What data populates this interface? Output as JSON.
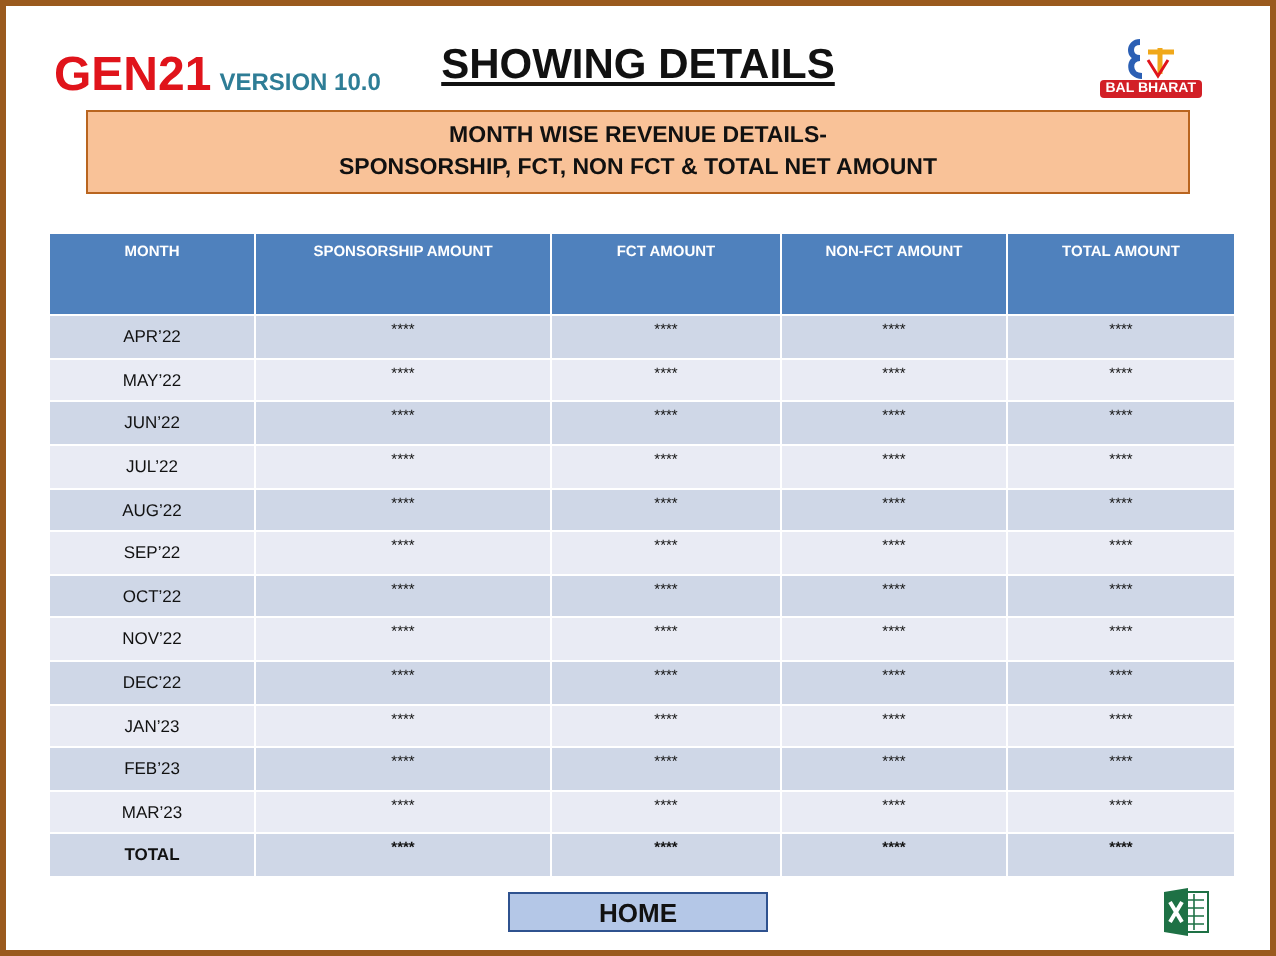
{
  "header": {
    "brand": "GEN21",
    "version": "VERSION 10.0",
    "title": "SHOWING DETAILS",
    "logo_badge": "BAL BHARAT"
  },
  "banner": {
    "lines": [
      "MONTH WISE REVENUE DETAILS-",
      "SPONSORSHIP, FCT, NON FCT & TOTAL NET AMOUNT"
    ]
  },
  "table": {
    "columns": [
      "MONTH",
      "SPONSORSHIP AMOUNT",
      "FCT AMOUNT",
      "NON-FCT AMOUNT",
      "TOTAL AMOUNT"
    ],
    "rows": [
      {
        "kind": "month",
        "cells": [
          "APR’22",
          "****",
          "****",
          "****",
          "****"
        ]
      },
      {
        "kind": "month",
        "cells": [
          "MAY’22",
          "****",
          "****",
          "****",
          "****"
        ]
      },
      {
        "kind": "month",
        "cells": [
          "JUN’22",
          "****",
          "****",
          "****",
          "****"
        ]
      },
      {
        "kind": "month",
        "cells": [
          "JUL’22",
          "****",
          "****",
          "****",
          "****"
        ]
      },
      {
        "kind": "month",
        "cells": [
          "AUG’22",
          "****",
          "****",
          "****",
          "****"
        ]
      },
      {
        "kind": "month",
        "cells": [
          "SEP’22",
          "****",
          "****",
          "****",
          "****"
        ]
      },
      {
        "kind": "month",
        "cells": [
          "OCT’22",
          "****",
          "****",
          "****",
          "****"
        ]
      },
      {
        "kind": "month",
        "cells": [
          "NOV’22",
          "****",
          "****",
          "****",
          "****"
        ]
      },
      {
        "kind": "month",
        "cells": [
          "DEC’22",
          "****",
          "****",
          "****",
          "****"
        ]
      },
      {
        "kind": "month",
        "cells": [
          "JAN’23",
          "****",
          "****",
          "****",
          "****"
        ]
      },
      {
        "kind": "month",
        "cells": [
          "FEB’23",
          "****",
          "****",
          "****",
          "****"
        ]
      },
      {
        "kind": "month",
        "cells": [
          "MAR’23",
          "****",
          "****",
          "****",
          "****"
        ]
      },
      {
        "kind": "total",
        "cells": [
          "TOTAL",
          "****",
          "****",
          "****",
          "****"
        ]
      }
    ]
  },
  "home_button": "HOME"
}
